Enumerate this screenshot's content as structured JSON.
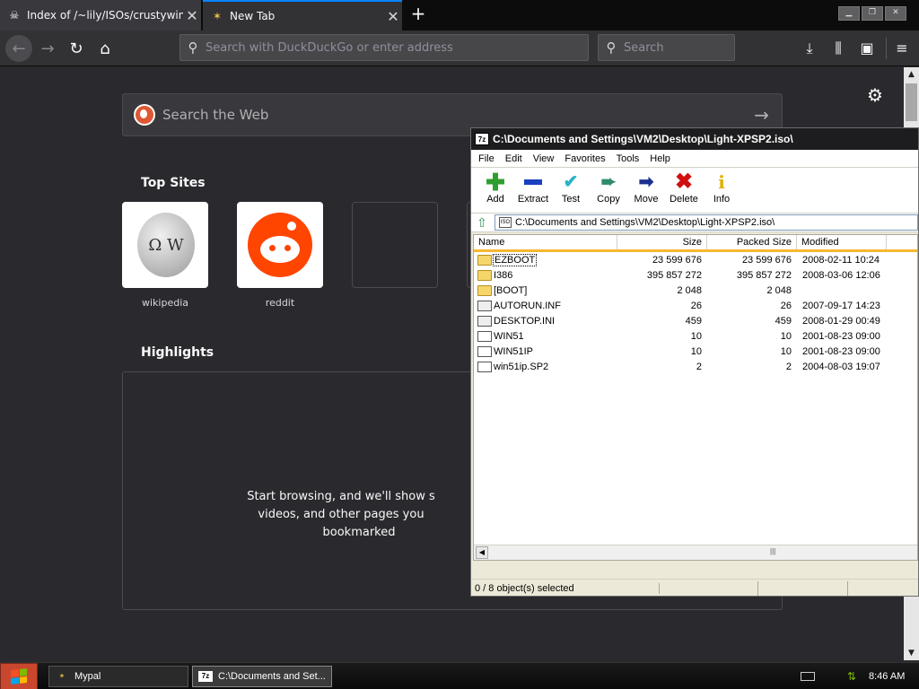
{
  "browser": {
    "tabs": [
      {
        "title": "Index of /~lily/ISOs/crustywindows",
        "icon": "ghost-icon"
      },
      {
        "title": "New Tab",
        "icon": "sparkle-icon"
      }
    ],
    "url_placeholder": "Search with DuckDuckGo or enter address",
    "search_placeholder": "Search"
  },
  "newtab": {
    "search_label": "Search the Web",
    "top_sites_title": "Top Sites",
    "top_sites": [
      "wikipedia",
      "reddit"
    ],
    "highlights_title": "Highlights",
    "highlights_empty_line1": "Start browsing, and we'll show s",
    "highlights_empty_line2": "videos, and other pages you",
    "highlights_empty_line3": "bookmarked"
  },
  "sevenzip": {
    "title": "C:\\Documents and Settings\\VM2\\Desktop\\Light-XPSP2.iso\\",
    "app_icon_text": "7z",
    "menu": [
      "File",
      "Edit",
      "View",
      "Favorites",
      "Tools",
      "Help"
    ],
    "toolbar": [
      {
        "label": "Add",
        "icon": "plus-icon",
        "color": "#2e9e2e"
      },
      {
        "label": "Extract",
        "icon": "minus-icon",
        "color": "#1a3fbf"
      },
      {
        "label": "Test",
        "icon": "checkmark-icon",
        "color": "#2bb3c8"
      },
      {
        "label": "Copy",
        "icon": "copy-arrow-icon",
        "color": "#2e8b6e"
      },
      {
        "label": "Move",
        "icon": "move-arrow-icon",
        "color": "#1a2f8f"
      },
      {
        "label": "Delete",
        "icon": "delete-x-icon",
        "color": "#d01010"
      },
      {
        "label": "Info",
        "icon": "info-icon",
        "color": "#e0b000"
      }
    ],
    "address": "C:\\Documents and Settings\\VM2\\Desktop\\Light-XPSP2.iso\\",
    "address_icon_text": "ISO",
    "columns": [
      "Name",
      "Size",
      "Packed Size",
      "Modified"
    ],
    "files": [
      {
        "name": "EZBOOT",
        "size": "23 599 676",
        "packed": "23 599 676",
        "modified": "2008-02-11 10:24",
        "type": "folder"
      },
      {
        "name": "I386",
        "size": "395 857 272",
        "packed": "395 857 272",
        "modified": "2008-03-06 12:06",
        "type": "folder"
      },
      {
        "name": "[BOOT]",
        "size": "2 048",
        "packed": "2 048",
        "modified": "",
        "type": "folder"
      },
      {
        "name": "AUTORUN.INF",
        "size": "26",
        "packed": "26",
        "modified": "2007-09-17 14:23",
        "type": "inf"
      },
      {
        "name": "DESKTOP.INI",
        "size": "459",
        "packed": "459",
        "modified": "2008-01-29 00:49",
        "type": "inf"
      },
      {
        "name": "WIN51",
        "size": "10",
        "packed": "10",
        "modified": "2001-08-23 09:00",
        "type": "file"
      },
      {
        "name": "WIN51IP",
        "size": "10",
        "packed": "10",
        "modified": "2001-08-23 09:00",
        "type": "file"
      },
      {
        "name": "win51ip.SP2",
        "size": "2",
        "packed": "2",
        "modified": "2004-08-03 19:07",
        "type": "file"
      }
    ],
    "status": "0 / 8 object(s) selected"
  },
  "taskbar": {
    "tasks": [
      "Mypal",
      "C:\\Documents and Set..."
    ],
    "clock": "8:46 AM"
  },
  "colors": {
    "accent": "#0a84ff",
    "reddit": "#ff4500",
    "ddg": "#de5833",
    "highlight_bar": "#f8b730"
  }
}
